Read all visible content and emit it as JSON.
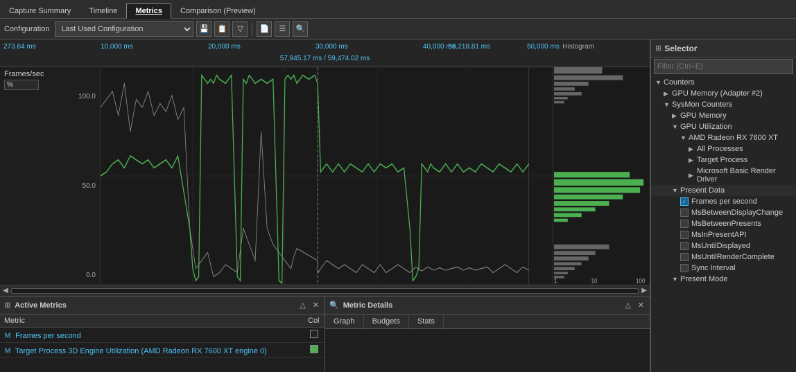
{
  "tabs": [
    {
      "id": "capture-summary",
      "label": "Capture Summary",
      "active": false
    },
    {
      "id": "timeline",
      "label": "Timeline",
      "active": false
    },
    {
      "id": "metrics",
      "label": "Metrics",
      "active": true
    },
    {
      "id": "comparison",
      "label": "Comparison (Preview)",
      "active": false
    }
  ],
  "toolbar": {
    "config_label": "Configuration",
    "config_value": "Last Used Configuration",
    "buttons": [
      "save-icon",
      "copy-icon",
      "dropdown-icon",
      "paste-icon",
      "list-icon",
      "search-icon"
    ]
  },
  "chart": {
    "time_labels": [
      "10,000 ms",
      "20,000 ms",
      "30,000 ms",
      "40,000 ms",
      "50,000 ms"
    ],
    "current_time": "273.64 ms",
    "range_time": "57,945.17 ms / 59,474.02 ms",
    "end_time": "58,218.81 ms",
    "histogram_title": "Histogram",
    "y_axis_title": "Frames/sec",
    "y_unit": "%",
    "y_labels": [
      "100.0",
      "50.0",
      "0.0"
    ]
  },
  "bottom_panels": {
    "active_metrics_title": "Active Metrics",
    "metric_details_title": "Metric Details",
    "metrics": [
      {
        "icon": "M",
        "label": "Frames per second",
        "color": "black"
      },
      {
        "icon": "M",
        "label": "Target Process 3D Engine Utilization (AMD Radeon RX 7600 XT engine 0)",
        "color": "green"
      }
    ],
    "columns": [
      "Metric",
      "Col"
    ],
    "detail_tabs": [
      "Graph",
      "Budgets",
      "Stats"
    ]
  },
  "selector": {
    "title": "Selector",
    "filter_placeholder": "Filter (Ctrl+E)",
    "tree": [
      {
        "label": "Counters",
        "indent": 0,
        "arrow": "▼",
        "type": "section"
      },
      {
        "label": "GPU Memory (Adapter #2)",
        "indent": 1,
        "arrow": "▶",
        "type": "item"
      },
      {
        "label": "SysMon Counters",
        "indent": 1,
        "arrow": "▼",
        "type": "item"
      },
      {
        "label": "GPU Memory",
        "indent": 2,
        "arrow": "▶",
        "type": "item"
      },
      {
        "label": "GPU Utilization",
        "indent": 2,
        "arrow": "▼",
        "type": "item"
      },
      {
        "label": "AMD Radeon RX 7600 XT",
        "indent": 3,
        "arrow": "▼",
        "type": "item"
      },
      {
        "label": "All Processes",
        "indent": 4,
        "arrow": "▶",
        "type": "item"
      },
      {
        "label": "Target Process",
        "indent": 4,
        "arrow": "▶",
        "type": "item"
      },
      {
        "label": "Microsoft Basic Render Driver",
        "indent": 4,
        "arrow": "▶",
        "type": "item"
      },
      {
        "label": "Present Data",
        "indent": 2,
        "arrow": "▼",
        "type": "section"
      },
      {
        "label": "Frames per second",
        "indent": 3,
        "arrow": "",
        "type": "checkbox",
        "checked": true
      },
      {
        "label": "MsBetweenDisplayChange",
        "indent": 3,
        "arrow": "",
        "type": "checkbox",
        "checked": false
      },
      {
        "label": "MsBetweenPresents",
        "indent": 3,
        "arrow": "",
        "type": "checkbox",
        "checked": false
      },
      {
        "label": "MsInPresentAPI",
        "indent": 3,
        "arrow": "",
        "type": "checkbox",
        "checked": false
      },
      {
        "label": "MsUntilDisplayed",
        "indent": 3,
        "arrow": "",
        "type": "checkbox",
        "checked": false
      },
      {
        "label": "MsUntilRenderComplete",
        "indent": 3,
        "arrow": "",
        "type": "checkbox",
        "checked": false
      },
      {
        "label": "Sync Interval",
        "indent": 3,
        "arrow": "",
        "type": "checkbox",
        "checked": false
      },
      {
        "label": "Present Mode",
        "indent": 2,
        "arrow": "▼",
        "type": "section"
      }
    ]
  }
}
